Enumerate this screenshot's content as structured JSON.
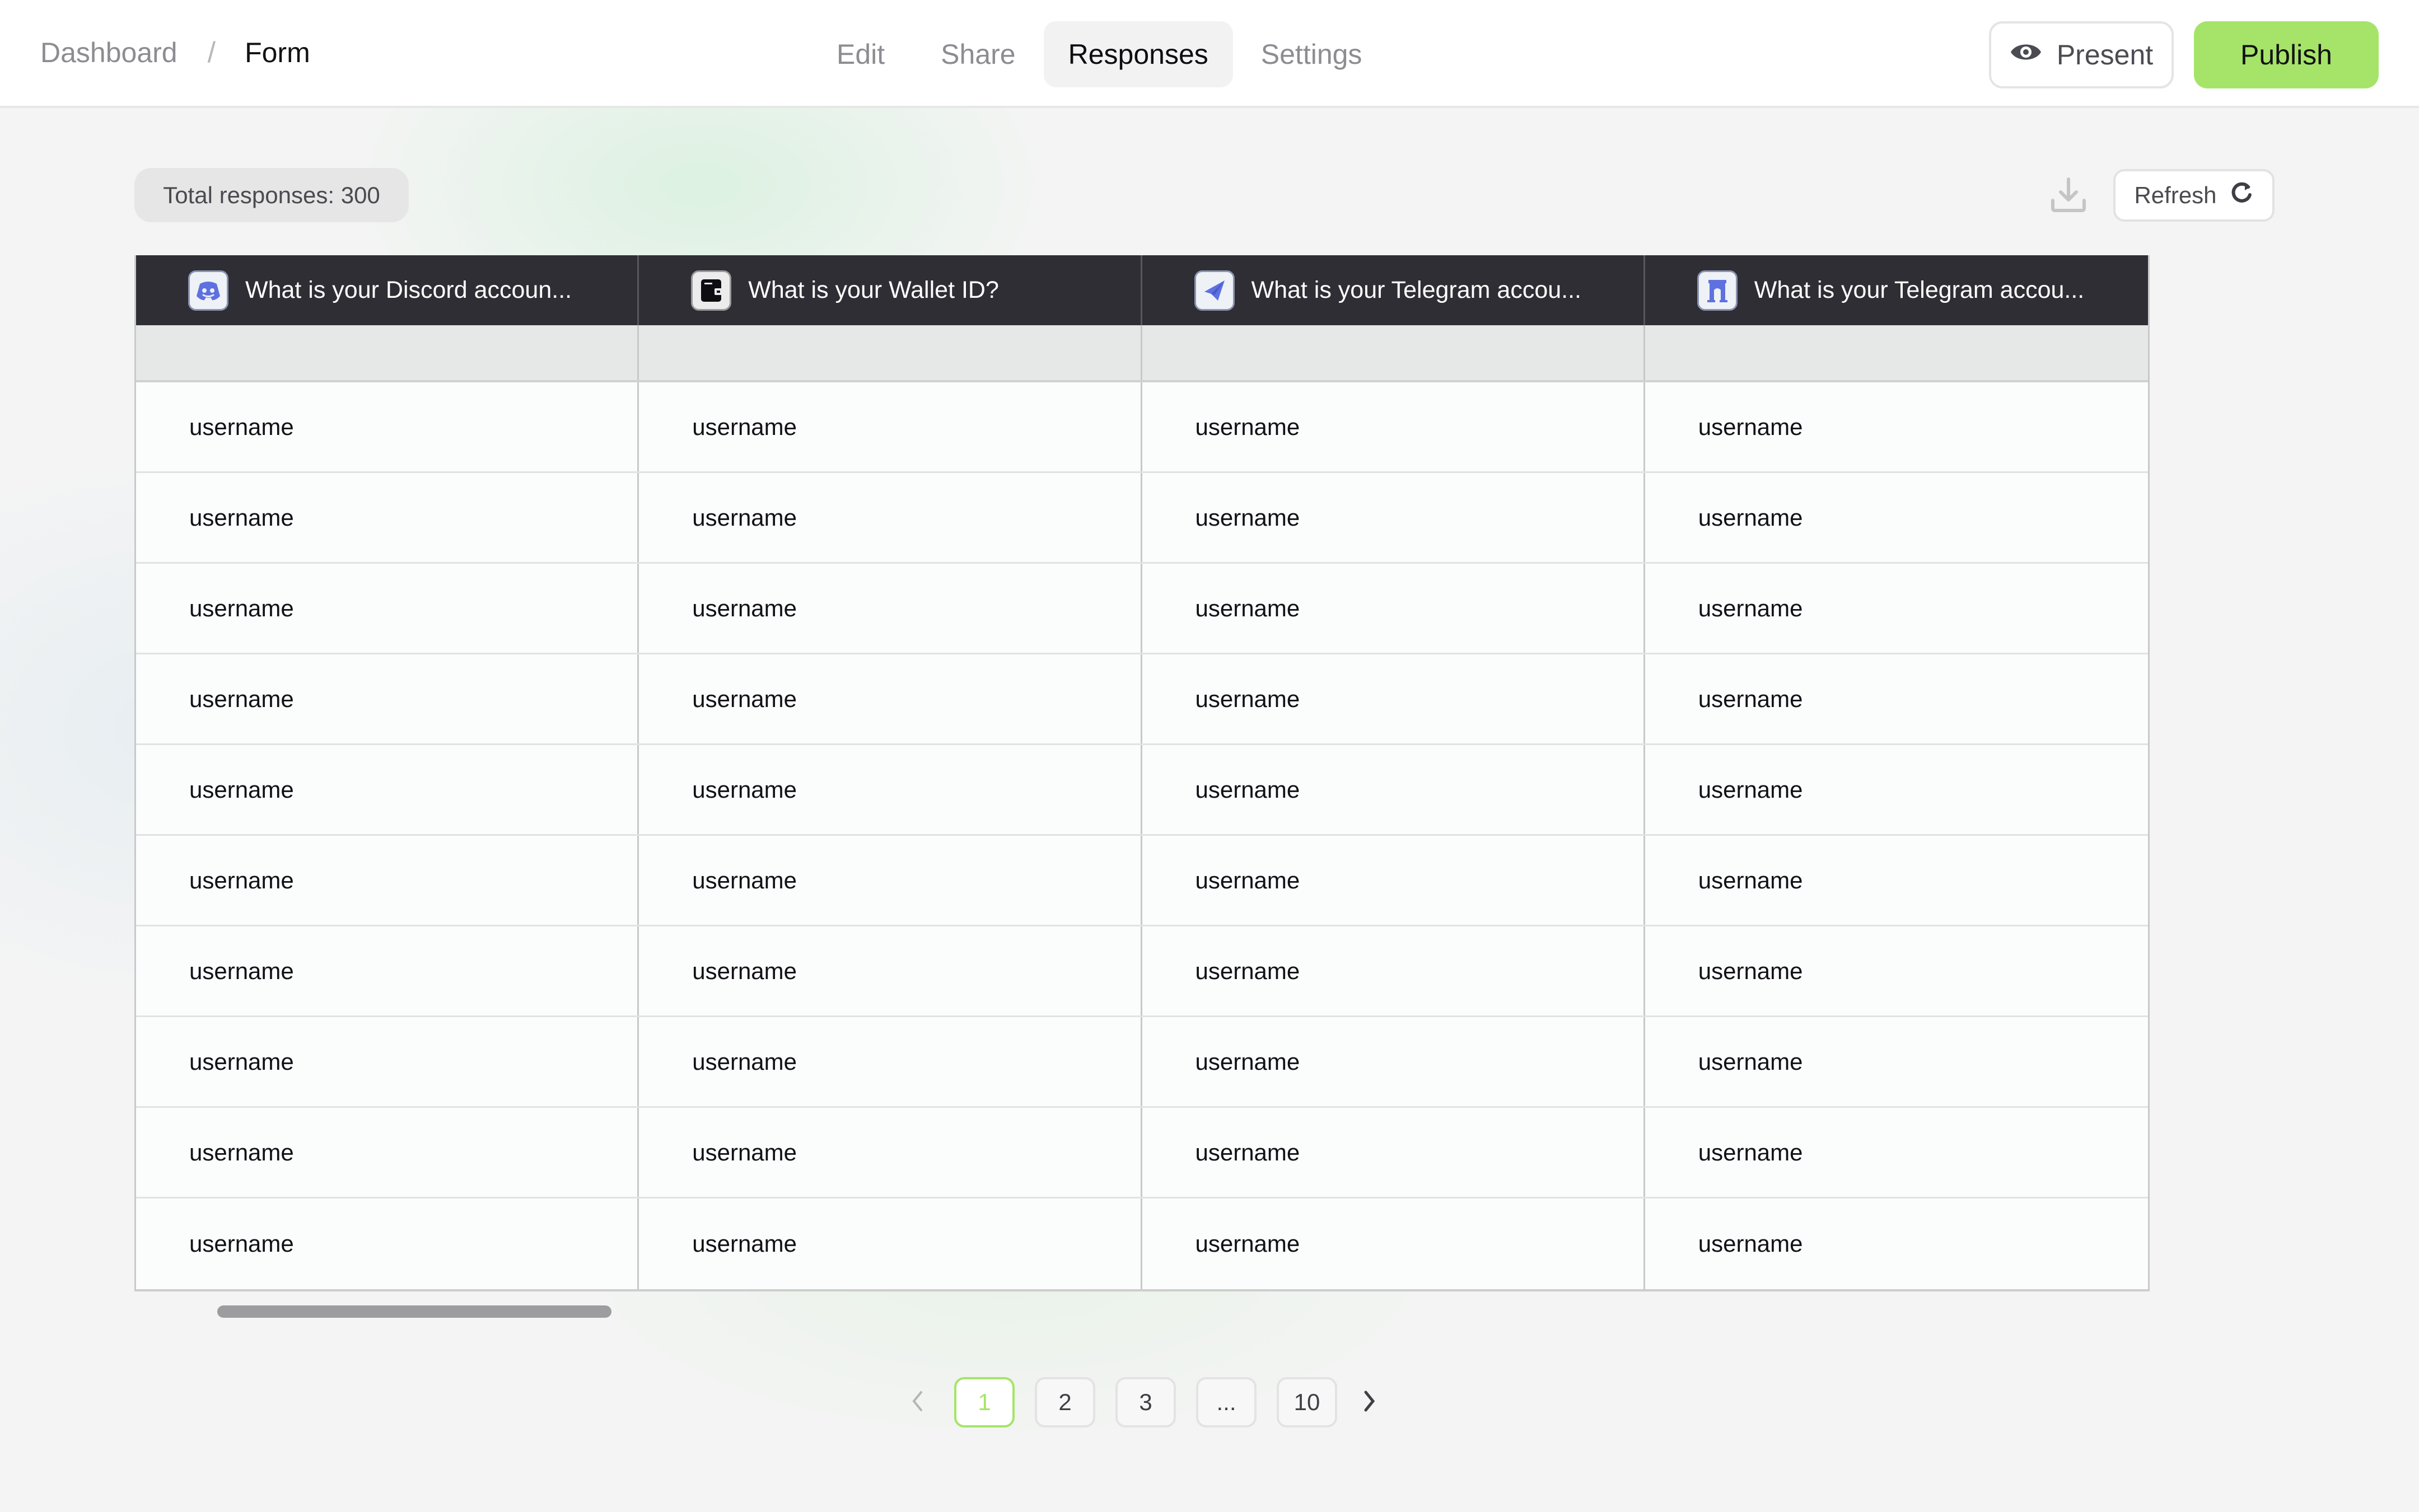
{
  "breadcrumb": {
    "parent": "Dashboard",
    "separator": "/",
    "current": "Form"
  },
  "tabs": [
    {
      "label": "Edit",
      "active": false
    },
    {
      "label": "Share",
      "active": false
    },
    {
      "label": "Responses",
      "active": true
    },
    {
      "label": "Settings",
      "active": false
    }
  ],
  "actions": {
    "present_label": "Present",
    "present_icon": "eye-icon",
    "publish_label": "Publish"
  },
  "toolbar": {
    "total_responses": "Total responses: 300",
    "download_icon": "download-icon",
    "refresh_label": "Refresh",
    "refresh_icon": "refresh-icon"
  },
  "table": {
    "columns": [
      {
        "label": "What is your Discord accoun...",
        "icon": "discord-icon"
      },
      {
        "label": "What is your Wallet ID?",
        "icon": "wallet-icon"
      },
      {
        "label": "What is your Telegram accou...",
        "icon": "telegram-icon"
      },
      {
        "label": "What is your Telegram accou...",
        "icon": "gate-icon"
      }
    ],
    "rows": [
      [
        "username",
        "username",
        "username",
        "username"
      ],
      [
        "username",
        "username",
        "username",
        "username"
      ],
      [
        "username",
        "username",
        "username",
        "username"
      ],
      [
        "username",
        "username",
        "username",
        "username"
      ],
      [
        "username",
        "username",
        "username",
        "username"
      ],
      [
        "username",
        "username",
        "username",
        "username"
      ],
      [
        "username",
        "username",
        "username",
        "username"
      ],
      [
        "username",
        "username",
        "username",
        "username"
      ],
      [
        "username",
        "username",
        "username",
        "username"
      ],
      [
        "username",
        "username",
        "username",
        "username"
      ]
    ]
  },
  "pagination": {
    "pages": [
      "1",
      "2",
      "3",
      "...",
      "10"
    ],
    "current": "1"
  },
  "colors": {
    "accent": "#a6e469",
    "header_bg": "#2f2e34",
    "icon_blue": "#5f71e0"
  }
}
